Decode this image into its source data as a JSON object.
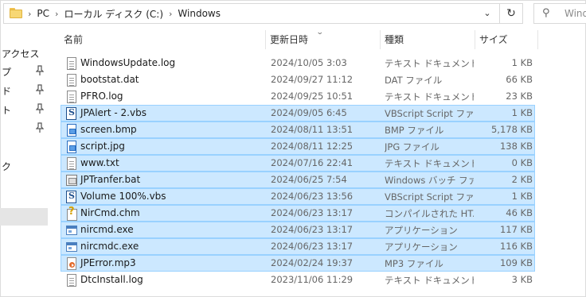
{
  "address": {
    "crumbs": [
      "PC",
      "ローカル ディスク (C:)",
      "Windows"
    ],
    "separator": "›"
  },
  "search": {
    "placeholder": "Windo"
  },
  "nav": {
    "items": [
      "アクセス",
      "プ",
      "ド",
      "ト",
      "",
      "ク"
    ]
  },
  "columns": {
    "name": "名前",
    "date": "更新日時",
    "type": "種類",
    "size": "サイズ"
  },
  "files": [
    {
      "name": "WindowsUpdate.log",
      "date": "2024/10/05 3:03",
      "type": "テキスト ドキュメント",
      "size": "1 KB",
      "icon": "text-file-icon",
      "selected": false
    },
    {
      "name": "bootstat.dat",
      "date": "2024/09/27 11:12",
      "type": "DAT ファイル",
      "size": "66 KB",
      "icon": "text-file-icon",
      "selected": false
    },
    {
      "name": "PFRO.log",
      "date": "2024/09/25 10:51",
      "type": "テキスト ドキュメント",
      "size": "23 KB",
      "icon": "text-file-icon",
      "selected": false
    },
    {
      "name": "JPAlert - 2.vbs",
      "date": "2024/09/05 6:45",
      "type": "VBScript Script ファ...",
      "size": "1 KB",
      "icon": "vbscript-icon",
      "selected": true
    },
    {
      "name": "screen.bmp",
      "date": "2024/08/11 13:51",
      "type": "BMP ファイル",
      "size": "5,178 KB",
      "icon": "image-file-icon",
      "selected": true
    },
    {
      "name": "script.jpg",
      "date": "2024/08/11 12:25",
      "type": "JPG ファイル",
      "size": "138 KB",
      "icon": "image-file-icon",
      "selected": true
    },
    {
      "name": "www.txt",
      "date": "2024/07/16 22:41",
      "type": "テキスト ドキュメント",
      "size": "0 KB",
      "icon": "text-file-icon",
      "selected": true
    },
    {
      "name": "JPTranfer.bat",
      "date": "2024/06/25 7:54",
      "type": "Windows バッチ ファ...",
      "size": "2 KB",
      "icon": "batch-file-icon",
      "selected": true
    },
    {
      "name": "Volume 100%.vbs",
      "date": "2024/06/23 13:56",
      "type": "VBScript Script ファ...",
      "size": "1 KB",
      "icon": "vbscript-icon",
      "selected": true
    },
    {
      "name": "NirCmd.chm",
      "date": "2024/06/23 13:17",
      "type": "コンパイルされた HT...",
      "size": "46 KB",
      "icon": "help-file-icon",
      "selected": true
    },
    {
      "name": "nircmd.exe",
      "date": "2024/06/23 13:17",
      "type": "アプリケーション",
      "size": "117 KB",
      "icon": "application-icon",
      "selected": true
    },
    {
      "name": "nircmdc.exe",
      "date": "2024/06/23 13:17",
      "type": "アプリケーション",
      "size": "116 KB",
      "icon": "application-icon",
      "selected": true
    },
    {
      "name": "JPError.mp3",
      "date": "2024/02/24 19:37",
      "type": "MP3 ファイル",
      "size": "109 KB",
      "icon": "audio-file-icon",
      "selected": true
    },
    {
      "name": "DtcInstall.log",
      "date": "2023/11/06 11:29",
      "type": "テキスト ドキュメント",
      "size": "3 KB",
      "icon": "text-file-icon",
      "selected": false
    }
  ],
  "colors": {
    "selection_bg": "#cce8ff",
    "selection_border": "#99d1ff",
    "folder": "#f7d774"
  }
}
